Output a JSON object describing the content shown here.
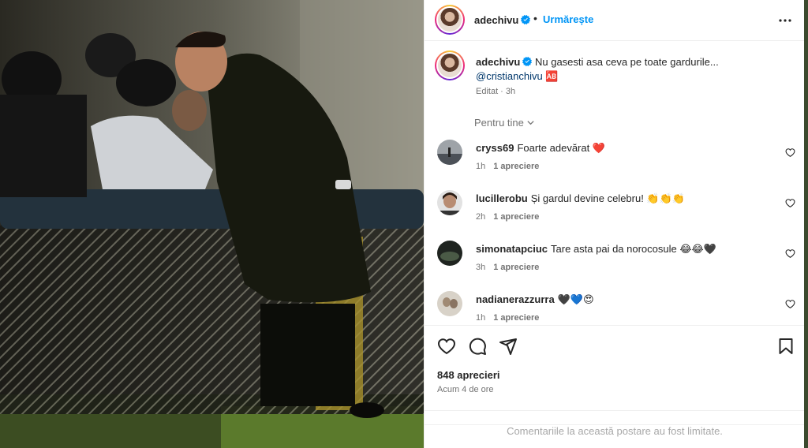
{
  "post": {
    "author": "adechivu",
    "separator": "•",
    "follow_label": "Urmărește",
    "caption_text": "Nu gasesti asa ceva pe toate gardurile...",
    "caption_mention": "@cristianchivu",
    "caption_emoji": "🆎",
    "edited": "Editat · 3h",
    "sort_label": "Pentru tine",
    "likes": "848 aprecieri",
    "posted_ago": "Acum 4 de ore",
    "comments_limited": "Comentariile la această postare au fost limitate."
  },
  "comments": [
    {
      "user": "cryss69",
      "text": "Foarte adevărat ❤️",
      "time": "1h",
      "likes": "1 apreciere"
    },
    {
      "user": "lucillerobu",
      "text": "Și gardul devine celebru! 👏👏👏",
      "time": "2h",
      "likes": "1 apreciere"
    },
    {
      "user": "simonatapciuc",
      "text": "Tare asta pai da norocosule 😂😂🖤",
      "time": "3h",
      "likes": "1 apreciere"
    },
    {
      "user": "nadianerazzurra",
      "text": "🖤💙😍",
      "time": "1h",
      "likes": "1 apreciere"
    }
  ],
  "colors": {
    "accent": "#0095f6",
    "verified": "#0095f6",
    "mention": "#00376b",
    "muted": "#737373"
  },
  "icons": [
    "verified-badge-icon",
    "more-options-icon",
    "chevron-down-icon",
    "heart-icon",
    "comment-icon",
    "share-icon",
    "bookmark-icon"
  ]
}
